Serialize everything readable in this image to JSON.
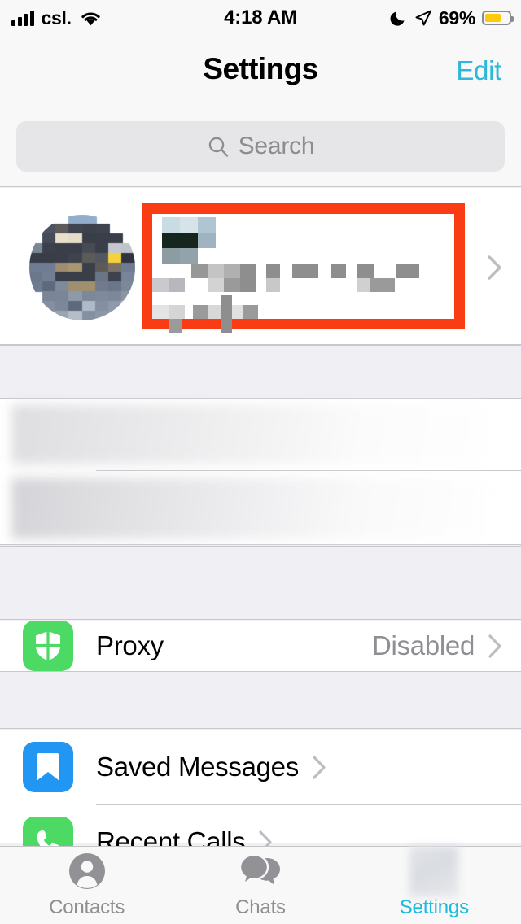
{
  "status_bar": {
    "carrier": "csl.",
    "time": "4:18 AM",
    "battery_percent": "69%",
    "battery_level": 69,
    "icons": [
      "signal-bars-icon",
      "wifi-icon",
      "do-not-disturb-moon-icon",
      "location-arrow-icon",
      "battery-icon"
    ]
  },
  "nav_bar": {
    "title": "Settings",
    "edit_label": "Edit"
  },
  "search": {
    "placeholder": "Search",
    "value": ""
  },
  "profile": {
    "avatar": "pixelated-user-avatar",
    "name": "",
    "phone": "",
    "username": "",
    "redacted": true,
    "highlight_color": "#FA3C14",
    "chevron": "chevron-right-icon"
  },
  "redacted_section": {
    "rows": [
      {
        "label": "",
        "redacted": true
      },
      {
        "label": "",
        "redacted": true
      }
    ]
  },
  "proxy_section": {
    "rows": [
      {
        "label": "Proxy",
        "value": "Disabled",
        "icon": "shield-icon",
        "icon_color": "#4CD964",
        "chevron": "chevron-right-icon"
      }
    ]
  },
  "list_section": {
    "rows": [
      {
        "label": "Saved Messages",
        "value": "",
        "icon": "bookmark-icon",
        "icon_color": "#2196F3",
        "chevron": "chevron-right-icon"
      },
      {
        "label": "Recent Calls",
        "value": "",
        "icon": "phone-icon",
        "icon_color": "#4CD964",
        "chevron": "chevron-right-icon"
      }
    ]
  },
  "tab_bar": {
    "active_color": "#1AB9E0",
    "inactive_color": "#8E8E93",
    "tabs": [
      {
        "label": "Contacts",
        "icon": "person-icon",
        "active": false
      },
      {
        "label": "Chats",
        "icon": "chat-bubbles-icon",
        "active": false
      },
      {
        "label": "Settings",
        "icon": "gear-icon-blurred",
        "active": true
      }
    ]
  }
}
